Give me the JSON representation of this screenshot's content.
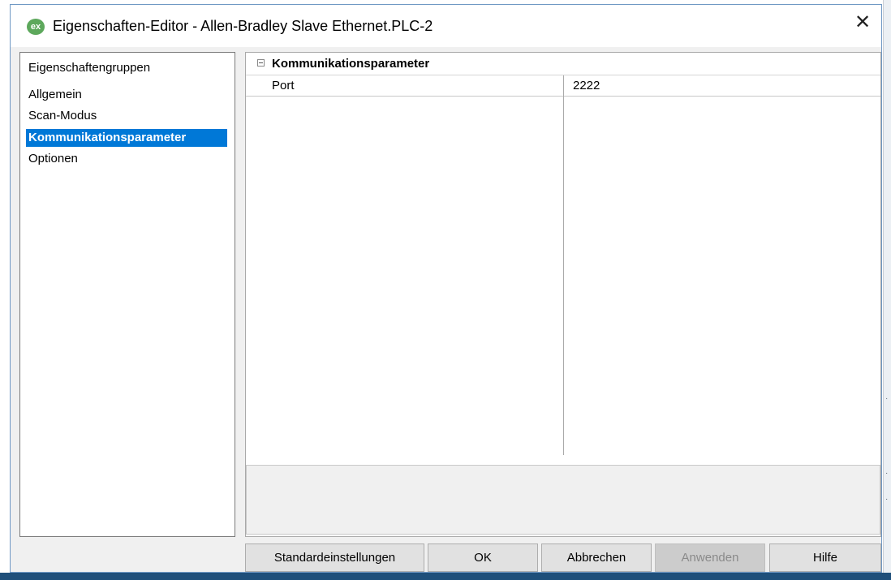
{
  "window": {
    "title": "Eigenschaften-Editor - Allen-Bradley Slave Ethernet.PLC-2",
    "app_icon_text": "ex",
    "close_glyph": "✕"
  },
  "sidebar": {
    "header": "Eigenschaftengruppen",
    "items": [
      {
        "label": "Allgemein"
      },
      {
        "label": "Scan-Modus"
      },
      {
        "label": "Kommunikationsparameter",
        "selected": true
      },
      {
        "label": "Optionen"
      }
    ]
  },
  "property_grid": {
    "section": "Kommunikationsparameter",
    "rows": [
      {
        "name": "Port",
        "value": "2222"
      }
    ]
  },
  "buttons": {
    "defaults": "Standardeinstellungen",
    "ok": "OK",
    "cancel": "Abbrechen",
    "apply": "Anwenden",
    "help": "Hilfe"
  }
}
